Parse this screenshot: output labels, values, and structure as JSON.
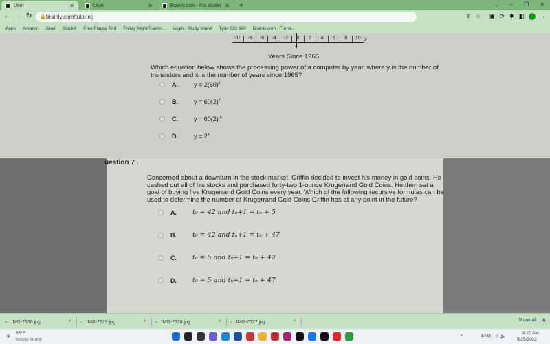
{
  "browser": {
    "tabs": [
      {
        "title": "User",
        "active": true
      },
      {
        "title": "User"
      },
      {
        "title": "Brainly.com - For students. By st..."
      }
    ],
    "new_tab": "+",
    "url": "brainly.com/tutoring",
    "bookmarks": [
      "Apps",
      "Amazon",
      "Goat",
      "StockX",
      "Free Flappy Bird",
      "Friday Night Funkin...",
      "Login - Study Island",
      "Tyler SIS 360",
      "Brainly.com - For st..."
    ]
  },
  "worksheet": {
    "number_line": {
      "ticks": [
        "-10",
        "-8",
        "-6",
        "-4",
        "-2",
        "0",
        "2",
        "4",
        "6",
        "8",
        "10"
      ],
      "axis_var": "x",
      "label": "Years Since 1965"
    },
    "q6": {
      "prompt": "Which equation below shows the processing power of a computer by year, where y is the number of transistors and x is the number of years since 1965?",
      "options": [
        {
          "letter": "A.",
          "text": "y = 2(60)",
          "sup": "x"
        },
        {
          "letter": "B.",
          "text": "y = 60(2)",
          "sup": "x"
        },
        {
          "letter": "C.",
          "text": "y = 60(2)",
          "sup": "-x"
        },
        {
          "letter": "D.",
          "text": "y = 2",
          "sup": "x"
        }
      ]
    },
    "q7": {
      "heading": "uestion 7 .",
      "prompt": "Concerned about a downturn in the stock market, Griffin decided to invest his money in gold coins. He cashed out all of his stocks and purchased forty-two 1-ounce Krugerrand Gold Coins. He then set a goal of buying five Krugerrand Gold Coins every year. Which of the following recursive formulas can be used to determine the number of Krugerrand Gold Coins Griffin has at any point in the future?",
      "options": [
        {
          "letter": "A.",
          "text": "t₀ = 42 and tₙ+1 = tₙ + 5"
        },
        {
          "letter": "B.",
          "text": "t₀ = 42 and tₙ+1 = tₙ + 47"
        },
        {
          "letter": "C.",
          "text": "t₀ = 5 and tₙ+1 = tₙ + 42"
        },
        {
          "letter": "D.",
          "text": "t₀ = 5 and tₙ+1 = tₙ + 47"
        }
      ]
    }
  },
  "downloads": {
    "files": [
      "IMG-7630.jpg",
      "IMG-7629.jpg",
      "IMG-7628.jpg",
      "IMG-7627.jpg"
    ],
    "show_all": "Show all"
  },
  "taskbar": {
    "temp": "85°F",
    "weather": "Mostly sunny",
    "lang": "ENG",
    "time": "9:20 AM",
    "date": "5/25/2022"
  }
}
